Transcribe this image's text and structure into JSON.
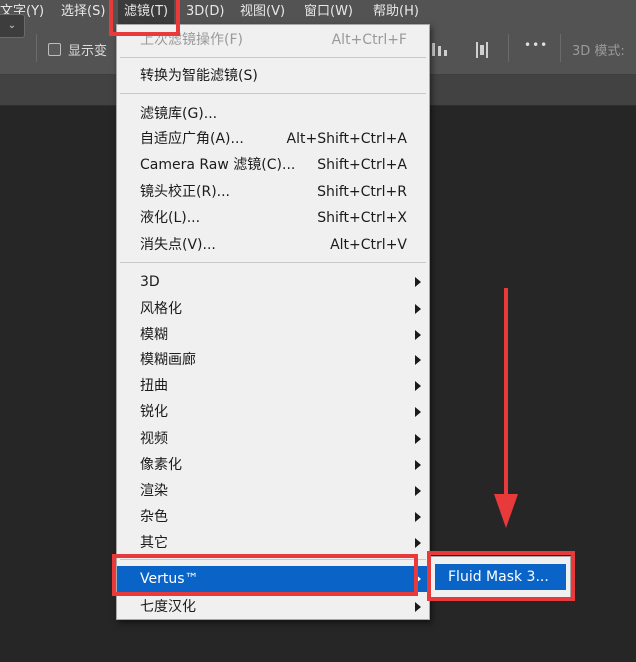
{
  "menubar": {
    "items": [
      {
        "label": "文字(Y)"
      },
      {
        "label": "选择(S)"
      },
      {
        "label": "滤镜(T)"
      },
      {
        "label": "3D(D)"
      },
      {
        "label": "视图(V)"
      },
      {
        "label": "窗口(W)"
      },
      {
        "label": "帮助(H)"
      }
    ]
  },
  "toolbar": {
    "dropdown_glyph": "⌄",
    "show_transform_label": "显示变",
    "more_glyph": "•••",
    "mode_label": "3D 模式:"
  },
  "filter_menu": {
    "items": [
      {
        "label": "上次滤镜操作(F)",
        "shortcut": "Alt+Ctrl+F",
        "disabled": true
      },
      {
        "label": "转换为智能滤镜(S)"
      },
      {
        "label": "滤镜库(G)..."
      },
      {
        "label": "自适应广角(A)...",
        "shortcut": "Alt+Shift+Ctrl+A"
      },
      {
        "label": "Camera Raw 滤镜(C)...",
        "shortcut": "Shift+Ctrl+A"
      },
      {
        "label": "镜头校正(R)...",
        "shortcut": "Shift+Ctrl+R"
      },
      {
        "label": "液化(L)...",
        "shortcut": "Shift+Ctrl+X"
      },
      {
        "label": "消失点(V)...",
        "shortcut": "Alt+Ctrl+V"
      },
      {
        "label": "3D",
        "submenu": true
      },
      {
        "label": "风格化",
        "submenu": true
      },
      {
        "label": "模糊",
        "submenu": true
      },
      {
        "label": "模糊画廊",
        "submenu": true
      },
      {
        "label": "扭曲",
        "submenu": true
      },
      {
        "label": "锐化",
        "submenu": true
      },
      {
        "label": "视频",
        "submenu": true
      },
      {
        "label": "像素化",
        "submenu": true
      },
      {
        "label": "渲染",
        "submenu": true
      },
      {
        "label": "杂色",
        "submenu": true
      },
      {
        "label": "其它",
        "submenu": true
      },
      {
        "label": "Vertus™",
        "submenu": true,
        "highlighted": true
      },
      {
        "label": "七度汉化",
        "submenu": true
      }
    ]
  },
  "submenu": {
    "item": "Fluid Mask 3..."
  },
  "colors": {
    "highlight": "#0a64c8",
    "annotation_red": "#e8393b",
    "menu_bg": "#f0f0f0",
    "canvas_bg": "#262626"
  }
}
